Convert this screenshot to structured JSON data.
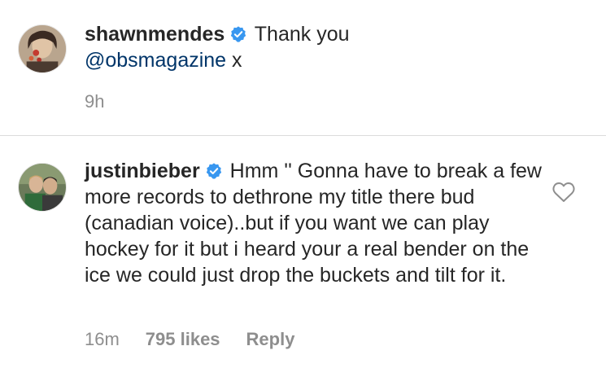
{
  "comments": [
    {
      "username": "shawnmendes",
      "text_before_mention": "Thank you",
      "mention": "@obsmagazine",
      "text_after_mention": "x",
      "time": "9h"
    },
    {
      "username": "justinbieber",
      "text": "Hmm '' Gonna have to break a few more records to dethrone my title there bud (canadian voice)..but if you want we can play hockey for it but i heard your a real bender on the ice  we could just drop the buckets and tilt for it.",
      "time": "16m",
      "likes": "795 likes",
      "reply_label": "Reply"
    }
  ],
  "colors": {
    "verified_badge": "#3897f0",
    "mention": "#003569",
    "meta_text": "#8e8e8e",
    "divider": "#dbdbdb"
  },
  "icons": {
    "verified": "verified-badge-icon",
    "like": "heart-outline-icon"
  }
}
